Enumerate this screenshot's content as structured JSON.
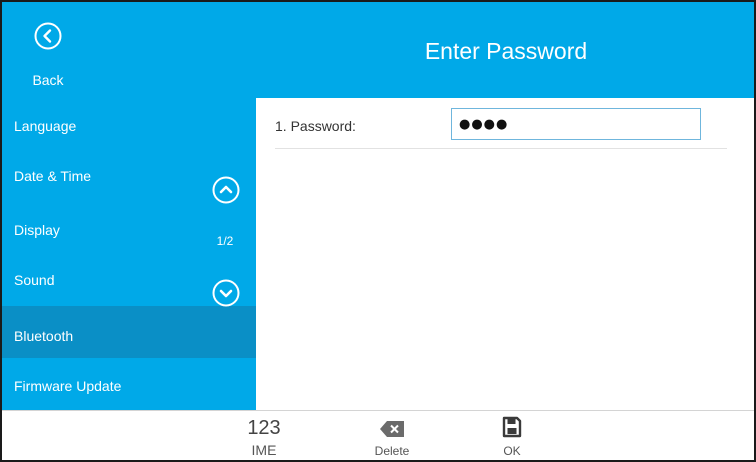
{
  "header": {
    "back_label": "Back",
    "title": "Enter Password"
  },
  "sidebar": {
    "items": [
      {
        "label": "Language",
        "active": false
      },
      {
        "label": "Date & Time",
        "active": false
      },
      {
        "label": "Display",
        "active": false
      },
      {
        "label": "Sound",
        "active": false
      },
      {
        "label": "Bluetooth",
        "active": true
      },
      {
        "label": "Firmware Update",
        "active": false
      }
    ],
    "page_indicator": "1/2"
  },
  "form": {
    "password_label": "1. Password:",
    "password_value": "●●●●"
  },
  "softkeys": {
    "ime_top": "123",
    "ime_bottom": "IME",
    "delete_label": "Delete",
    "ok_label": "OK"
  },
  "colors": {
    "accent": "#00a9e8",
    "sidebar_active": "#0a8fc6",
    "input_border": "#6fb6dd"
  }
}
